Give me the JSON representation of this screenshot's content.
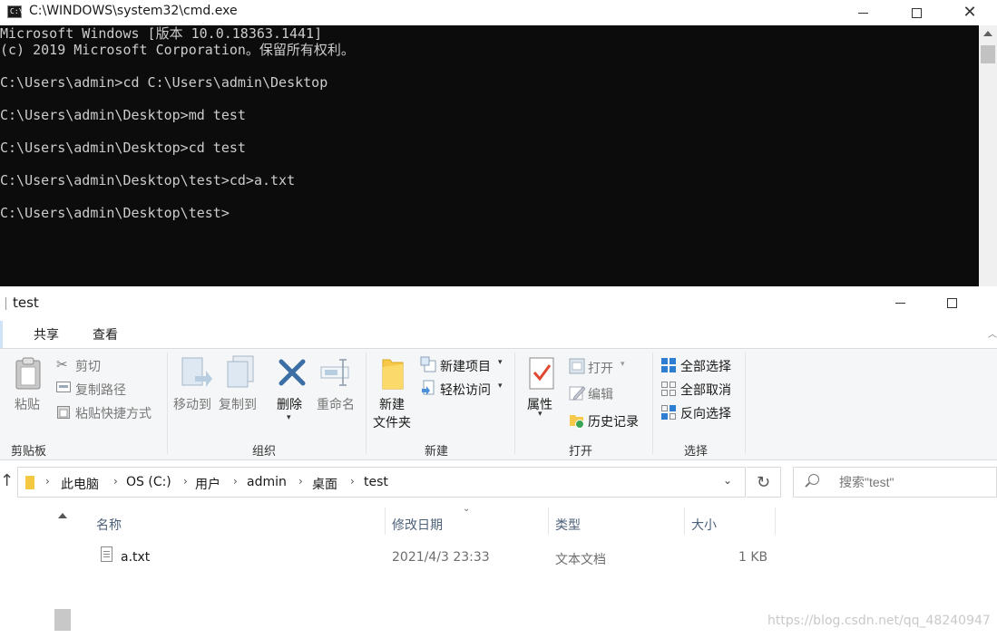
{
  "cmd": {
    "title": "C:\\WINDOWS\\system32\\cmd.exe",
    "lines": [
      "Microsoft Windows [版本 10.0.18363.1441]",
      "(c) 2019 Microsoft Corporation。保留所有权利。",
      "",
      "C:\\Users\\admin>cd C:\\Users\\admin\\Desktop",
      "",
      "C:\\Users\\admin\\Desktop>md test",
      "",
      "C:\\Users\\admin\\Desktop>cd test",
      "",
      "C:\\Users\\admin\\Desktop\\test>cd>a.txt",
      "",
      "C:\\Users\\admin\\Desktop\\test>"
    ]
  },
  "explorer": {
    "title": "test",
    "tabs": [
      "共享",
      "查看"
    ],
    "ribbon": {
      "clipboard": {
        "paste": "粘贴",
        "cut": "剪切",
        "copy_path": "复制路径",
        "paste_shortcut": "粘贴快捷方式",
        "label": "剪贴板"
      },
      "organize": {
        "move_to": "移动到",
        "copy_to": "复制到",
        "delete": "删除",
        "rename": "重命名",
        "label": "组织"
      },
      "new": {
        "new_folder_1": "新建",
        "new_folder_2": "文件夹",
        "new_item": "新建项目",
        "easy_access": "轻松访问",
        "label": "新建"
      },
      "open": {
        "properties": "属性",
        "open": "打开",
        "edit": "编辑",
        "history": "历史记录",
        "label": "打开"
      },
      "select": {
        "select_all": "全部选择",
        "select_none": "全部取消",
        "invert": "反向选择",
        "label": "选择"
      }
    },
    "breadcrumb": [
      "此电脑",
      "OS (C:)",
      "用户",
      "admin",
      "桌面",
      "test"
    ],
    "search_placeholder": "搜索\"test\"",
    "columns": {
      "name": "名称",
      "modified": "修改日期",
      "type": "类型",
      "size": "大小"
    },
    "files": [
      {
        "name": "a.txt",
        "modified": "2021/4/3 23:33",
        "type": "文本文档",
        "size": "1 KB"
      }
    ]
  },
  "watermark": "https://blog.csdn.net/qq_48240947",
  "colors": {
    "cmd_bg": "#0c0c0c",
    "cmd_text": "#cccccc",
    "ribbon_bg": "#f5f6f7",
    "select_icon_blue": "#2d7dd2"
  }
}
